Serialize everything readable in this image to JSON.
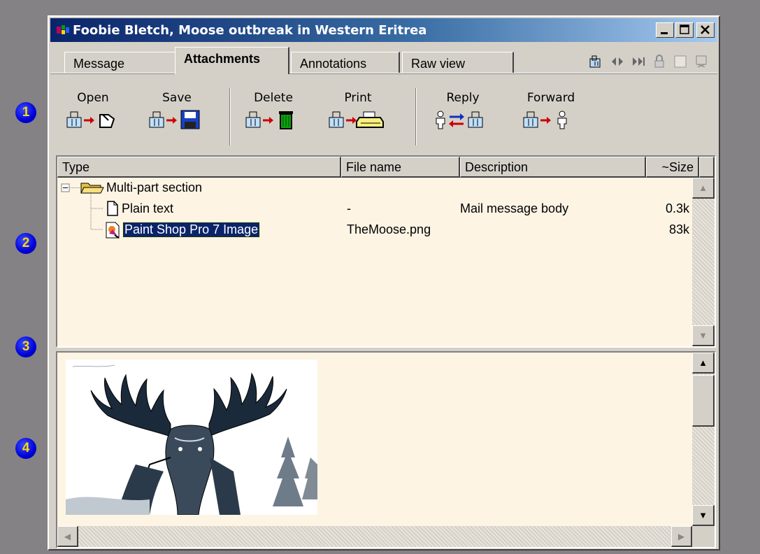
{
  "window": {
    "title": "Foobie Bletch, Moose outbreak in Western Eritrea"
  },
  "markers": [
    "1",
    "2",
    "3",
    "4"
  ],
  "tabs": [
    {
      "label": "Message",
      "active": false
    },
    {
      "label": "Attachments",
      "active": true
    },
    {
      "label": "Annotations",
      "active": false
    },
    {
      "label": "Raw view",
      "active": false
    }
  ],
  "tab_icons": [
    "attachment-icon",
    "prev-next-icon",
    "skip-icon",
    "lock-icon",
    "checkbox-icon",
    "decrypt-icon"
  ],
  "toolbar": {
    "open": "Open",
    "save": "Save",
    "delete": "Delete",
    "print": "Print",
    "reply": "Reply",
    "forward": "Forward"
  },
  "list": {
    "columns": [
      "Type",
      "File name",
      "Description",
      "~Size"
    ],
    "rows": [
      {
        "type": "Multi-part section",
        "file": "",
        "description": "",
        "size": ""
      },
      {
        "type": "Plain text",
        "file": "-",
        "description": "Mail message body",
        "size": "0.3k"
      },
      {
        "type": "Paint Shop Pro 7 Image",
        "file": "TheMoose.png",
        "description": "",
        "size": "83k",
        "selected": true
      }
    ]
  },
  "colors": {
    "panel_bg": "#fdf4e4",
    "title_start": "#0a246a",
    "title_end": "#a6caf0",
    "marker_fill": "#0000d8",
    "marker_text": "#ffd800"
  }
}
